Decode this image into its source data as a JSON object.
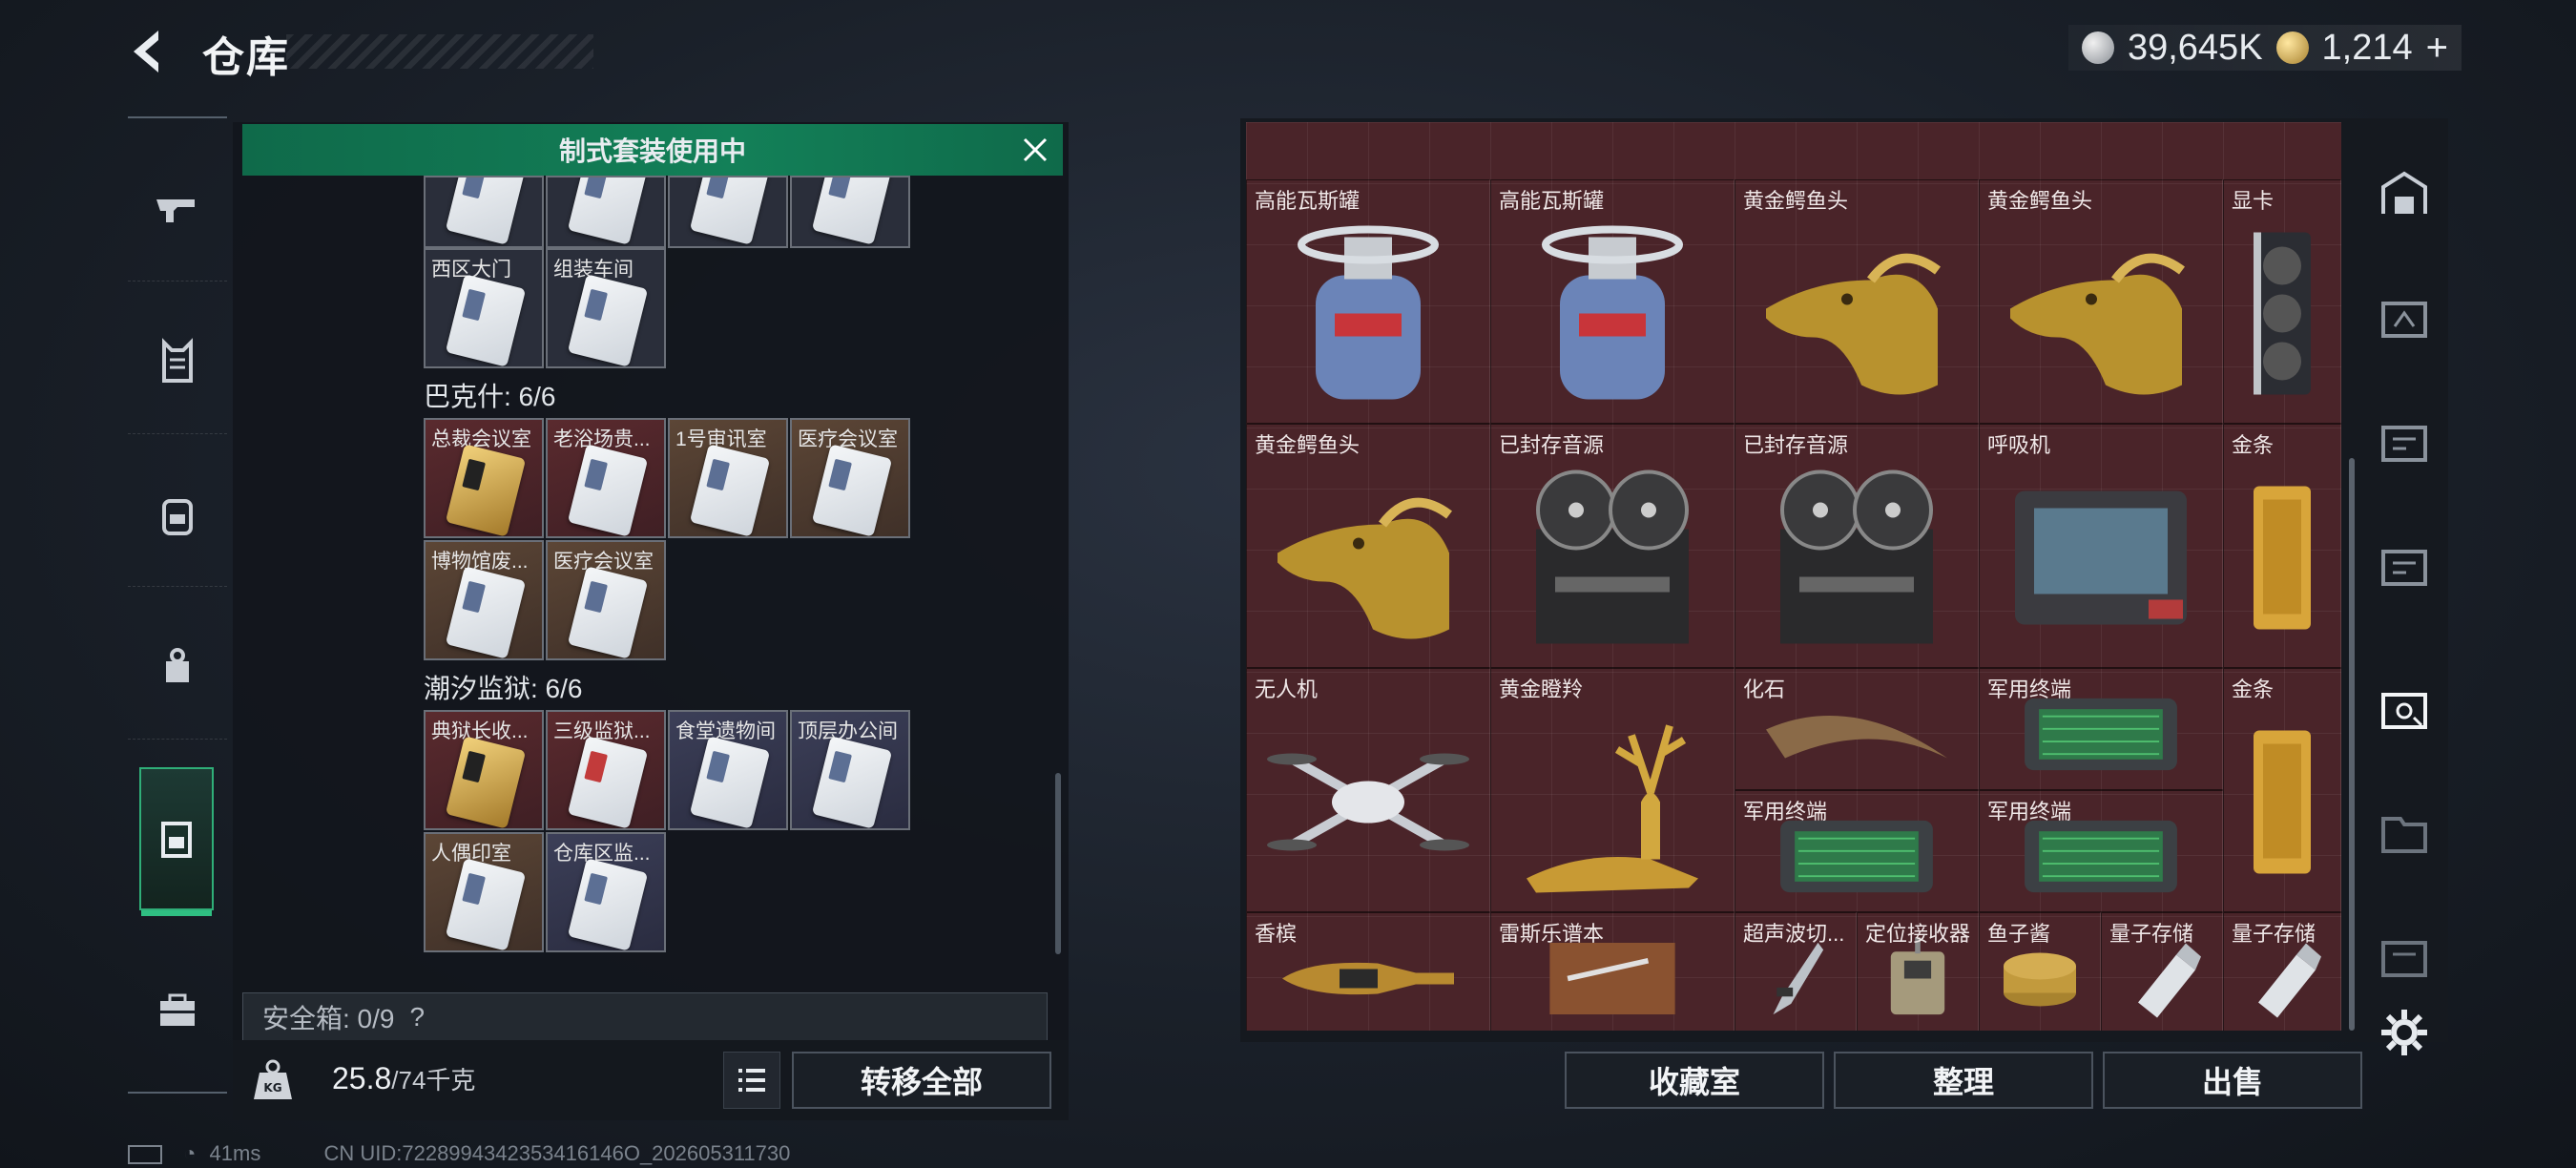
{
  "header": {
    "title": "仓库"
  },
  "currency": {
    "silver": "39,645K",
    "gold": "1,214"
  },
  "left_nav": [
    "weapon",
    "armor",
    "backpack",
    "bag",
    "container",
    "toolbox"
  ],
  "banner": {
    "text": "制式套装使用中"
  },
  "groups": [
    {
      "title": "",
      "cells": [
        {
          "label": "",
          "style": "dark",
          "card": "white"
        },
        {
          "label": "",
          "style": "dark",
          "card": "white"
        },
        {
          "label": "",
          "style": "dark",
          "card": "white"
        },
        {
          "label": "",
          "style": "dark",
          "card": "white"
        },
        {
          "label": "西区大门",
          "style": "dark",
          "card": "white"
        },
        {
          "label": "组装车间",
          "style": "dark",
          "card": "white"
        }
      ]
    },
    {
      "title": "巴克什: 6/6",
      "cells": [
        {
          "label": "总裁会议室",
          "style": "red",
          "card": "gold"
        },
        {
          "label": "老浴场贵...",
          "style": "red",
          "card": "white"
        },
        {
          "label": "1号审讯室",
          "style": "gold",
          "card": "white"
        },
        {
          "label": "医疗会议室",
          "style": "gold",
          "card": "white"
        },
        {
          "label": "博物馆废...",
          "style": "gold",
          "card": "white"
        },
        {
          "label": "医疗会议室",
          "style": "gold",
          "card": "white"
        }
      ]
    },
    {
      "title": "潮汐监狱: 6/6",
      "cells": [
        {
          "label": "典狱长收...",
          "style": "red",
          "card": "gold"
        },
        {
          "label": "三级监狱...",
          "style": "red",
          "card": "white-r"
        },
        {
          "label": "食堂遗物间",
          "style": "blue",
          "card": "white"
        },
        {
          "label": "顶层办公间",
          "style": "blue",
          "card": "white"
        },
        {
          "label": "人偶印室",
          "style": "gold",
          "card": "white"
        },
        {
          "label": "仓库区监...",
          "style": "blue",
          "card": "white"
        }
      ]
    }
  ],
  "safebox": {
    "text": "安全箱: 0/9",
    "help": "?"
  },
  "weight": {
    "current": "25.8",
    "max": "/74千克"
  },
  "buttons": {
    "transfer_all": "转移全部",
    "collection": "收藏室",
    "organize": "整理",
    "sell": "出售"
  },
  "items": [
    {
      "label": "高能瓦斯罐",
      "kind": "gas"
    },
    {
      "label": "高能瓦斯罐",
      "kind": "gas"
    },
    {
      "label": "黄金鳄鱼头",
      "kind": "croc"
    },
    {
      "label": "黄金鳄鱼头",
      "kind": "croc"
    },
    {
      "label": "显卡",
      "kind": "gpu"
    },
    {
      "label": "黄金鳄鱼头",
      "kind": "croc"
    },
    {
      "label": "已封存音源",
      "kind": "reel"
    },
    {
      "label": "已封存音源",
      "kind": "reel"
    },
    {
      "label": "呼吸机",
      "kind": "vent"
    },
    {
      "label": "金条",
      "kind": "goldbar"
    },
    {
      "label": "无人机",
      "kind": "drone"
    },
    {
      "label": "黄金瞪羚",
      "kind": "deer"
    },
    {
      "label": "化石",
      "kind": "fossil"
    },
    {
      "label": "军用终端",
      "kind": "terminal"
    },
    {
      "label": "金条",
      "kind": "goldbar"
    },
    {
      "label": "军用终端",
      "kind": "terminal"
    },
    {
      "label": "军用终端",
      "kind": "terminal"
    },
    {
      "label": "香槟",
      "kind": "champagne"
    },
    {
      "label": "雷斯乐谱本",
      "kind": "book"
    },
    {
      "label": "超声波切...",
      "kind": "knife"
    },
    {
      "label": "定位接收器",
      "kind": "receiver"
    },
    {
      "label": "鱼子酱",
      "kind": "caviar"
    },
    {
      "label": "量子存储",
      "kind": "usb"
    },
    {
      "label": "量子存储",
      "kind": "usb"
    }
  ],
  "status": {
    "ping": "41ms",
    "uid": "CN UID:7228994342353416146O_202605311730"
  },
  "colors": {
    "accent_green": "#138058",
    "grid_bg": "#4a2429"
  }
}
